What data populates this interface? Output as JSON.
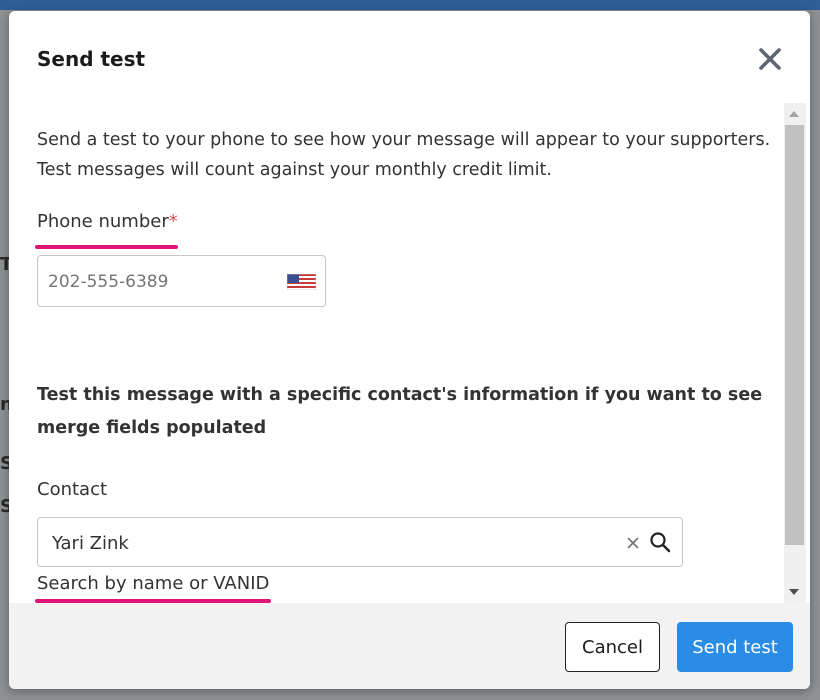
{
  "background": {
    "fragments": [
      "Tr",
      "nc",
      "S",
      "S"
    ]
  },
  "modal": {
    "title": "Send test",
    "intro": "Send a test to your phone to see how your message will appear to your supporters. Test messages will count against your monthly credit limit.",
    "phone": {
      "label": "Phone number",
      "required_mark": "*",
      "placeholder": "202-555-6389",
      "value": "",
      "flag_icon": "us-flag-icon"
    },
    "merge_text": "Test this message with a specific contact's information if you want to see merge fields populated",
    "contact": {
      "label": "Contact",
      "value": "Yari Zink",
      "helper": "Search by name or VANID"
    },
    "footer": {
      "cancel_label": "Cancel",
      "send_label": "Send test"
    }
  },
  "colors": {
    "primary": "#2b8ce6",
    "required": "#d9534f",
    "highlight": "#e0147a",
    "topbar": "#2f5f96"
  }
}
